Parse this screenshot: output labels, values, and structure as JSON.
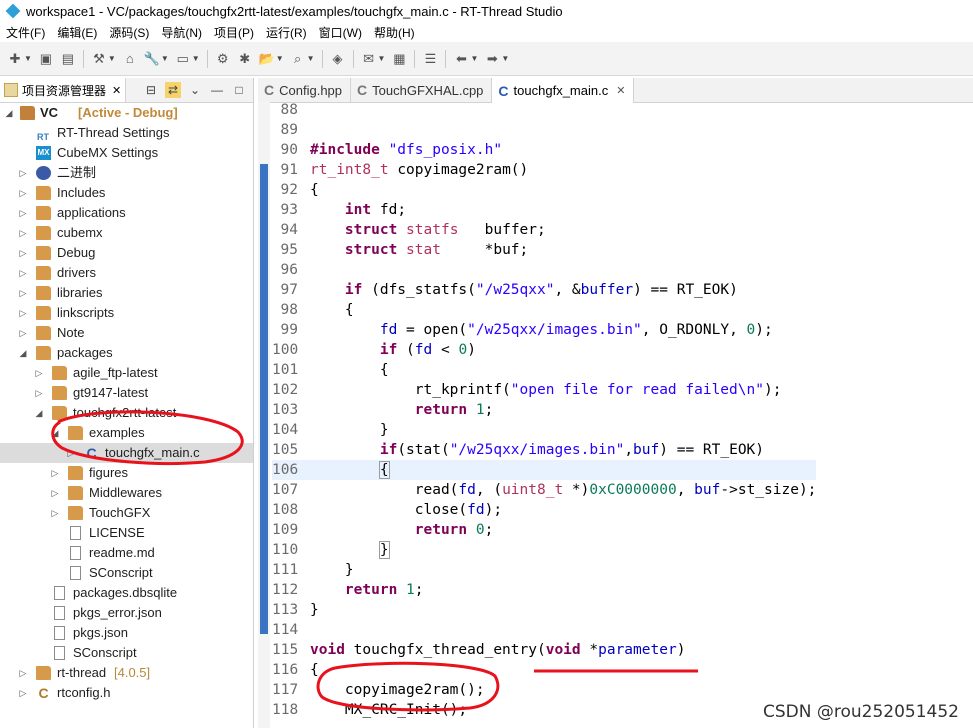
{
  "window": {
    "title": "workspace1 - VC/packages/touchgfx2rtt-latest/examples/touchgfx_main.c - RT-Thread Studio"
  },
  "menu": [
    "文件(F)",
    "编辑(E)",
    "源码(S)",
    "导航(N)",
    "项目(P)",
    "运行(R)",
    "窗口(W)",
    "帮助(H)"
  ],
  "left_panel": {
    "tab_label": "项目资源管理器",
    "tree": [
      {
        "label": "VC",
        "suffix": "[Active - Debug]"
      },
      {
        "label": "RT-Thread Settings"
      },
      {
        "label": "CubeMX Settings"
      },
      {
        "label": "二进制"
      },
      {
        "label": "Includes"
      },
      {
        "label": "applications"
      },
      {
        "label": "cubemx"
      },
      {
        "label": "Debug"
      },
      {
        "label": "drivers"
      },
      {
        "label": "libraries"
      },
      {
        "label": "linkscripts"
      },
      {
        "label": "Note"
      },
      {
        "label": "packages"
      },
      {
        "label": "agile_ftp-latest"
      },
      {
        "label": "gt9147-latest"
      },
      {
        "label": "touchgfx2rtt-latest"
      },
      {
        "label": "examples"
      },
      {
        "label": "touchgfx_main.c"
      },
      {
        "label": "figures"
      },
      {
        "label": "Middlewares"
      },
      {
        "label": "TouchGFX"
      },
      {
        "label": "LICENSE"
      },
      {
        "label": "readme.md"
      },
      {
        "label": "SConscript"
      },
      {
        "label": "packages.dbsqlite"
      },
      {
        "label": "pkgs_error.json"
      },
      {
        "label": "pkgs.json"
      },
      {
        "label": "SConscript"
      },
      {
        "label": "rt-thread",
        "suffix": "[4.0.5]"
      },
      {
        "label": "rtconfig.h"
      }
    ]
  },
  "editor": {
    "tabs": [
      {
        "label": "Config.hpp"
      },
      {
        "label": "TouchGFXHAL.cpp"
      },
      {
        "label": "touchgfx_main.c"
      }
    ],
    "line_numbers": [
      "88",
      "89",
      "90",
      "91",
      "92",
      "93",
      "94",
      "95",
      "96",
      "97",
      "98",
      "99",
      "100",
      "101",
      "102",
      "103",
      "104",
      "105",
      "106",
      "107",
      "108",
      "109",
      "110",
      "111",
      "112",
      "113",
      "114",
      "115",
      "116",
      "117",
      "118"
    ]
  },
  "watermark": "CSDN @rou252051452",
  "colors": {
    "annotation": "#e8121c",
    "accent": "#3a73c1"
  }
}
